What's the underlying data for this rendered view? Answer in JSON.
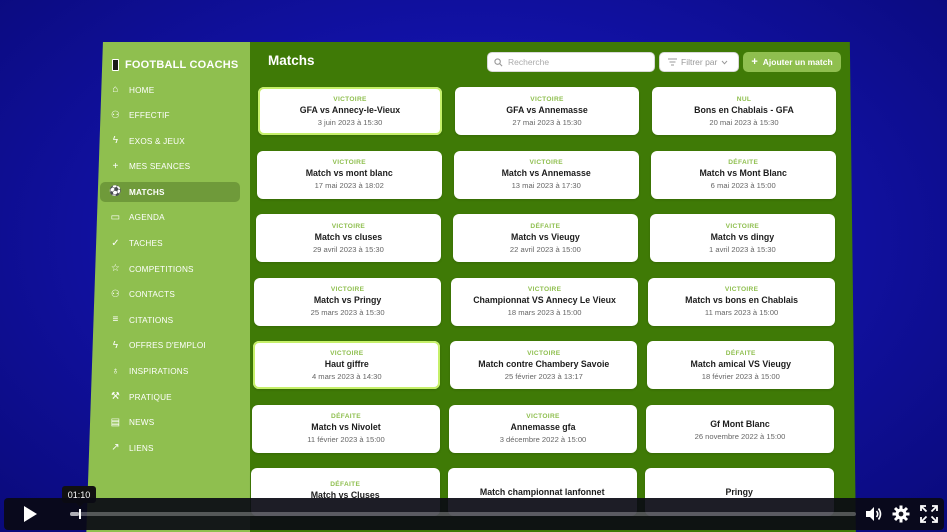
{
  "sidebar": {
    "brand": "FOOTBALL COACHS",
    "items": [
      {
        "label": "HOME",
        "icon": "home-icon",
        "glyph": "⌂"
      },
      {
        "label": "EFFECTIF",
        "icon": "user-icon",
        "glyph": "⚇"
      },
      {
        "label": "EXOS & JEUX",
        "icon": "lightning-icon",
        "glyph": "ϟ"
      },
      {
        "label": "MES SEANCES",
        "icon": "plus-icon",
        "glyph": "+"
      },
      {
        "label": "MATCHS",
        "icon": "football-icon",
        "glyph": "⚽",
        "active": true
      },
      {
        "label": "AGENDA",
        "icon": "calendar-icon",
        "glyph": "▭"
      },
      {
        "label": "TACHES",
        "icon": "check-circle-icon",
        "glyph": "✓"
      },
      {
        "label": "COMPETITIONS",
        "icon": "star-icon",
        "glyph": "☆"
      },
      {
        "label": "CONTACTS",
        "icon": "contacts-icon",
        "glyph": "⚇"
      },
      {
        "label": "CITATIONS",
        "icon": "list-icon",
        "glyph": "≡"
      },
      {
        "label": "OFFRES D'EMPLOI",
        "icon": "lightning-icon",
        "glyph": "ϟ"
      },
      {
        "label": "INSPIRATIONS",
        "icon": "bulb-icon",
        "glyph": "♁"
      },
      {
        "label": "PRATIQUE",
        "icon": "tool-icon",
        "glyph": "⚒"
      },
      {
        "label": "NEWS",
        "icon": "news-icon",
        "glyph": "▤"
      },
      {
        "label": "LIENS",
        "icon": "external-link-icon",
        "glyph": "↗"
      }
    ]
  },
  "header": {
    "title": "Matchs",
    "search_placeholder": "Recherche",
    "filter_label": "Filtrer par",
    "add_label": "Ajouter un match"
  },
  "matches": [
    {
      "status": "VICTOIRE",
      "title": "GFA vs Annecy-le-Vieux",
      "date": "3 juin 2023 à 15:30",
      "highlight": true
    },
    {
      "status": "VICTOIRE",
      "title": "GFA vs Annemasse",
      "date": "27 mai 2023 à 15:30"
    },
    {
      "status": "NUL",
      "title": "Bons en Chablais - GFA",
      "date": "20 mai 2023 à 15:30"
    },
    {
      "status": "VICTOIRE",
      "title": "Match vs mont blanc",
      "date": "17 mai 2023 à 18:02"
    },
    {
      "status": "VICTOIRE",
      "title": "Match vs Annemasse",
      "date": "13 mai 2023 à 17:30"
    },
    {
      "status": "DÉFAITE",
      "title": "Match vs Mont Blanc",
      "date": "6 mai 2023 à 15:00"
    },
    {
      "status": "VICTOIRE",
      "title": "Match vs cluses",
      "date": "29 avril 2023 à 15:30"
    },
    {
      "status": "DÉFAITE",
      "title": "Match vs Vieugy",
      "date": "22 avril 2023 à 15:00"
    },
    {
      "status": "VICTOIRE",
      "title": "Match vs dingy",
      "date": "1 avril 2023 à 15:30"
    },
    {
      "status": "VICTOIRE",
      "title": "Match vs Pringy",
      "date": "25 mars 2023 à 15:30"
    },
    {
      "status": "VICTOIRE",
      "title": "Championnat VS Annecy Le Vieux",
      "date": "18 mars 2023 à 15:00"
    },
    {
      "status": "VICTOIRE",
      "title": "Match vs bons en Chablais",
      "date": "11 mars 2023 à 15:00"
    },
    {
      "status": "VICTOIRE",
      "title": "Haut giffre",
      "date": "4 mars 2023 à 14:30",
      "highlight": true
    },
    {
      "status": "VICTOIRE",
      "title": "Match contre Chambery Savoie",
      "date": "25 février 2023 à 13:17"
    },
    {
      "status": "DÉFAITE",
      "title": "Match amical VS Vieugy",
      "date": "18 février 2023 à 15:00"
    },
    {
      "status": "DÉFAITE",
      "title": "Match vs Nivolet",
      "date": "11 février 2023 à 15:00"
    },
    {
      "status": "VICTOIRE",
      "title": "Annemasse gfa",
      "date": "3 décembre 2022 à 15:00"
    },
    {
      "status": "",
      "title": "Gf Mont Blanc",
      "date": "26 novembre 2022 à 15:00"
    },
    {
      "status": "DÉFAITE",
      "title": "Match vs Cluses",
      "date": ""
    },
    {
      "status": "",
      "title": "Match championnat lanfonnet",
      "date": ""
    },
    {
      "status": "",
      "title": "Pringy",
      "date": ""
    }
  ],
  "player": {
    "time_tooltip": "01:10",
    "progress": 0.012,
    "icons": [
      "play-icon",
      "volume-icon",
      "settings-icon",
      "fullscreen-icon"
    ]
  }
}
